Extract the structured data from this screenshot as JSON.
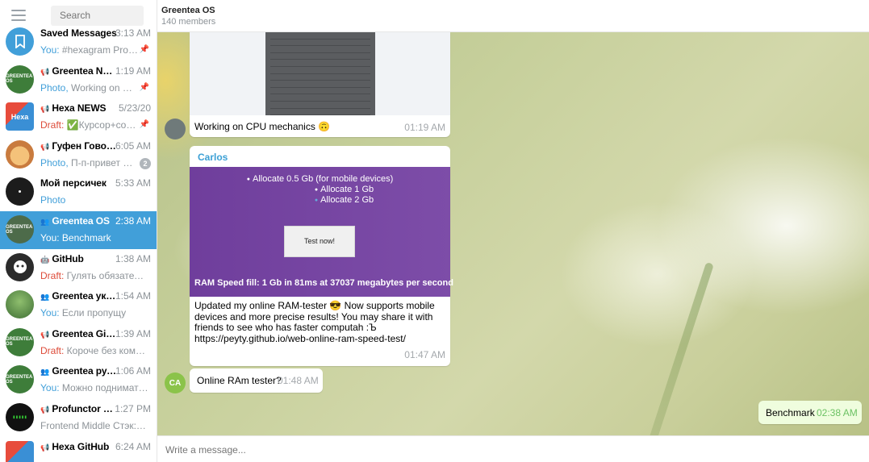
{
  "sidebar": {
    "search_placeholder": "Search",
    "chats": [
      {
        "name": "Saved Messages",
        "time": "3:13 AM",
        "who": "You: ",
        "preview": "#hexagram Proba...",
        "pinned": true,
        "avatar_color": "#419fd9",
        "avatar_icon": "bookmark-icon"
      },
      {
        "name": "Greentea NEWS",
        "name_icon": "📢",
        "time": "1:19 AM",
        "who": "Photo, ",
        "preview": "Working on CPU...",
        "pinned": true,
        "avatar_color": "#3e7d3a",
        "avatar_text": "GREENTEA OS"
      },
      {
        "name": "Hexa NEWS",
        "name_icon": "📢",
        "time": "5/23/20",
        "draft": "Draft: ",
        "preview": "✅Курсор+com...",
        "pinned": true,
        "avatar_color": "#3a8fd5",
        "avatar_text": "Hexa"
      },
      {
        "name": "Гуфен Говорит",
        "name_icon": "📢",
        "time": "6:05 AM",
        "who": "Photo, ",
        "preview": "П-п-привет х-х...",
        "badge": "2",
        "avatar_color": "#e9a85a"
      },
      {
        "name": "Мой персичек",
        "time": "5:33 AM",
        "who": "Photo",
        "preview": "",
        "avatar_color": "#1c1c1c"
      },
      {
        "name": "Greentea OS",
        "name_icon": "👥",
        "time": "2:38 AM",
        "who": "You: ",
        "preview": "Benchmark",
        "active": true,
        "avatar_color": "#4d6b4a",
        "avatar_text": "GREENTEA OS"
      },
      {
        "name": "GitHub",
        "name_icon": "🤖",
        "time": "1:38 AM",
        "draft": "Draft: ",
        "preview": "Гулять обязательн...",
        "avatar_color": "#2b2b2b"
      },
      {
        "name": "Greentea укра...",
        "name_icon": "👥",
        "time": "1:54 AM",
        "who": "You: ",
        "preview": "Если пропущу",
        "avatar_color": "#5c8d4f"
      },
      {
        "name": "Greentea GitHub",
        "name_icon": "📢",
        "time": "1:39 AM",
        "draft": "Draft: ",
        "preview": "Короче без коман...",
        "avatar_color": "#3e7d3a",
        "avatar_text": "GREENTEA OS"
      },
      {
        "name": "Greentea русс...",
        "name_icon": "👥",
        "time": "1:06 AM",
        "who": "You: ",
        "preview": "Можно поднимать ...",
        "avatar_color": "#3e7d3a",
        "avatar_text": "GREENTEA OS"
      },
      {
        "name": "Profunctor Jobs",
        "name_icon": "📢",
        "time": "1:27 PM",
        "who": "",
        "preview": "Frontend Middle Стэк: Re...",
        "avatar_color": "#111111"
      },
      {
        "name": "Hexa GitHub",
        "name_icon": "📢",
        "time": "6:24 AM",
        "who": "",
        "preview": "",
        "avatar_color": "#3a8fd5"
      }
    ]
  },
  "header": {
    "title": "Greentea OS",
    "subtitle": "140 members"
  },
  "messages": {
    "m1": {
      "text": "Working on CPU mechanics 🙃",
      "time": "01:19 AM"
    },
    "m2": {
      "sender": "Carlos",
      "options": [
        "Allocate 0.5 Gb (for mobile devices)",
        "Allocate 1 Gb",
        "Allocate 2 Gb"
      ],
      "test_button": "Test now!",
      "stat": "RAM Speed fill: 1 Gb in 81ms at 37037 megabytes per second",
      "text": "Updated my online RAM-tester 😎 Now supports mobile devices and more precise results! You may share it with friends to see who has faster computah :Ъ https://peyty.github.io/web-online-ram-speed-test/",
      "time": "01:47 AM"
    },
    "m3": {
      "avatar": "CA",
      "text": "Online RAm tester?",
      "time": "01:48 AM"
    },
    "m4": {
      "text": "Benchmark",
      "time": "02:38 AM"
    }
  },
  "composer": {
    "placeholder": "Write a message..."
  },
  "colors": {
    "accent": "#419fd9",
    "outgoing": "#effdde",
    "purple": "#7548a3"
  }
}
